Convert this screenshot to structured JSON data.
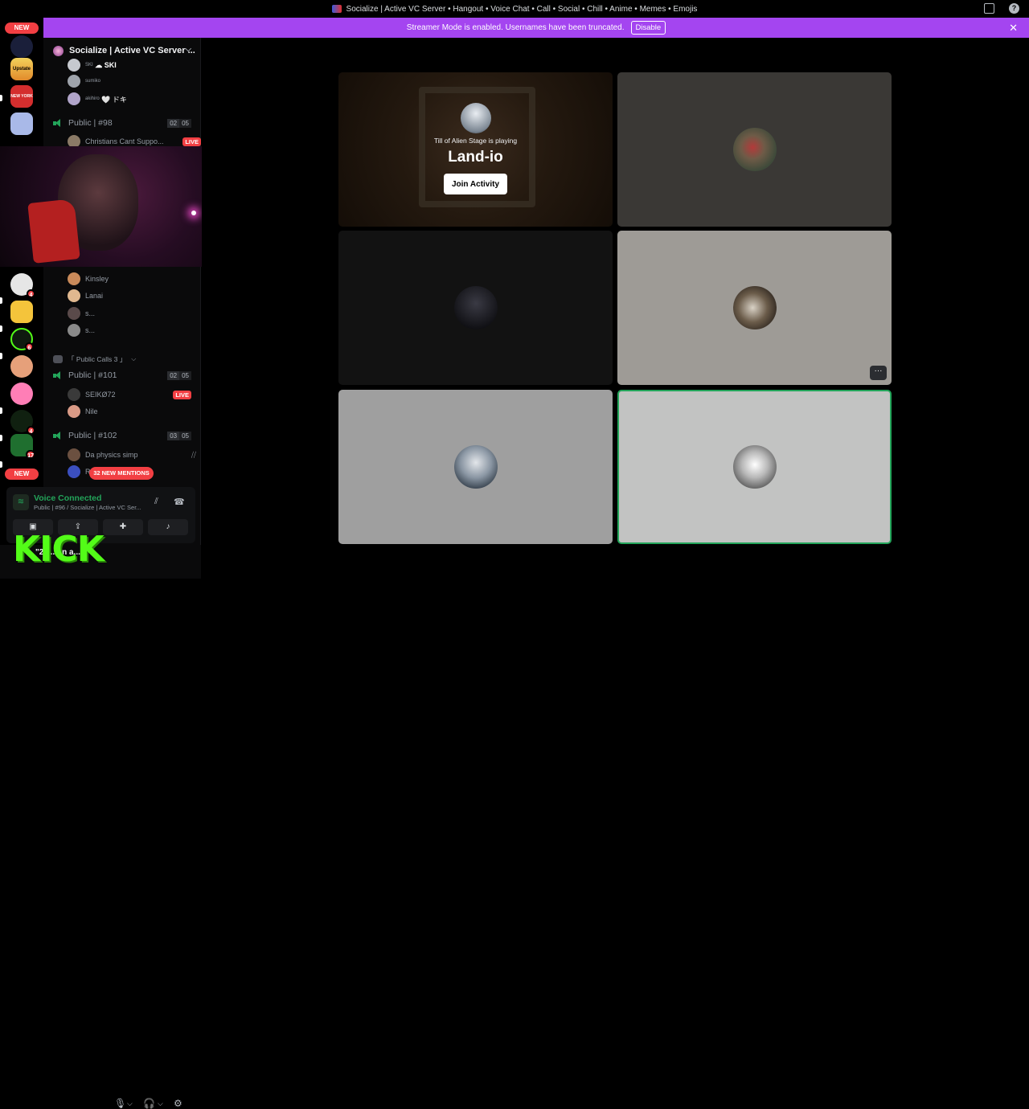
{
  "window": {
    "title": "Socialize | Active VC Server • Hangout • Voice Chat • Call • Social • Chill • Anime • Memes • Emojis"
  },
  "banner": {
    "text": "Streamer Mode is enabled. Usernames have been truncated.",
    "disable_label": "Disable"
  },
  "rail": {
    "new_top": "NEW",
    "new_bottom": "NEW",
    "badges": [
      "4",
      "6",
      "4",
      "17"
    ],
    "server_labels": [
      "Upstate",
      "NEW YORK"
    ]
  },
  "sidebar": {
    "server_name": "Socialize | Active VC Server ...",
    "top_members": [
      {
        "name": "SKI",
        "suffix": "☁ SKI"
      },
      {
        "name": "sumiko",
        "suffix": ""
      },
      {
        "name": "akihiro",
        "suffix": "🤍 ドキ"
      }
    ],
    "channel_98": {
      "name": "Public | #98",
      "count": "02",
      "limit": "05"
    },
    "live_member": {
      "name": "Christians Cant Suppo...",
      "live": "LIVE"
    },
    "members_b": [
      {
        "name": "Kinsley"
      },
      {
        "name": "Lanai"
      },
      {
        "name": "s..."
      },
      {
        "name": "s..."
      }
    ],
    "category": "「 Public Calls 3 」",
    "channel_101": {
      "name": "Public | #101",
      "count": "02",
      "limit": "05"
    },
    "members_101": [
      {
        "name": "SEIKØ72",
        "live": "LIVE"
      },
      {
        "name": "Nile"
      }
    ],
    "channel_102": {
      "name": "Public | #102",
      "count": "03",
      "limit": "05"
    },
    "members_102": [
      {
        "name": "Da physics simp"
      },
      {
        "name": "R"
      }
    ],
    "mentions": "32 NEW MENTIONS"
  },
  "voice": {
    "title": "Voice Connected",
    "subtitle": "Public | #96 / Socialize | Active VC Ser..."
  },
  "user": {
    "name": "\"29... on a..."
  },
  "overlay": {
    "kick_logo": "KICK"
  },
  "activity": {
    "line": "Till of Alien Stage is playing",
    "name": "Land-io",
    "button": "Join Activity"
  },
  "tile_more": "···"
}
